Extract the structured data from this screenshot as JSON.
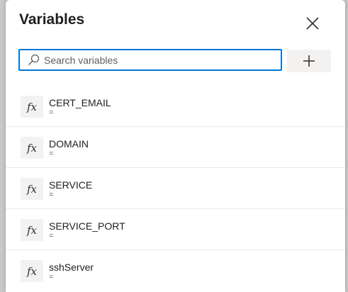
{
  "dialog": {
    "title": "Variables",
    "close_icon": "close-icon"
  },
  "search": {
    "placeholder": "Search variables",
    "value": "",
    "icon": "search-icon"
  },
  "add_button": {
    "icon": "plus-icon"
  },
  "variables": [
    {
      "icon": "fx",
      "name": "CERT_EMAIL",
      "value": "="
    },
    {
      "icon": "fx",
      "name": "DOMAIN",
      "value": "="
    },
    {
      "icon": "fx",
      "name": "SERVICE",
      "value": "="
    },
    {
      "icon": "fx",
      "name": "SERVICE_PORT",
      "value": "="
    },
    {
      "icon": "fx",
      "name": "sshServer",
      "value": "="
    }
  ],
  "colors": {
    "accent": "#0078d4",
    "text_primary": "#201f1e",
    "text_secondary": "#605e5c",
    "button_bg": "#f3f2f1"
  }
}
